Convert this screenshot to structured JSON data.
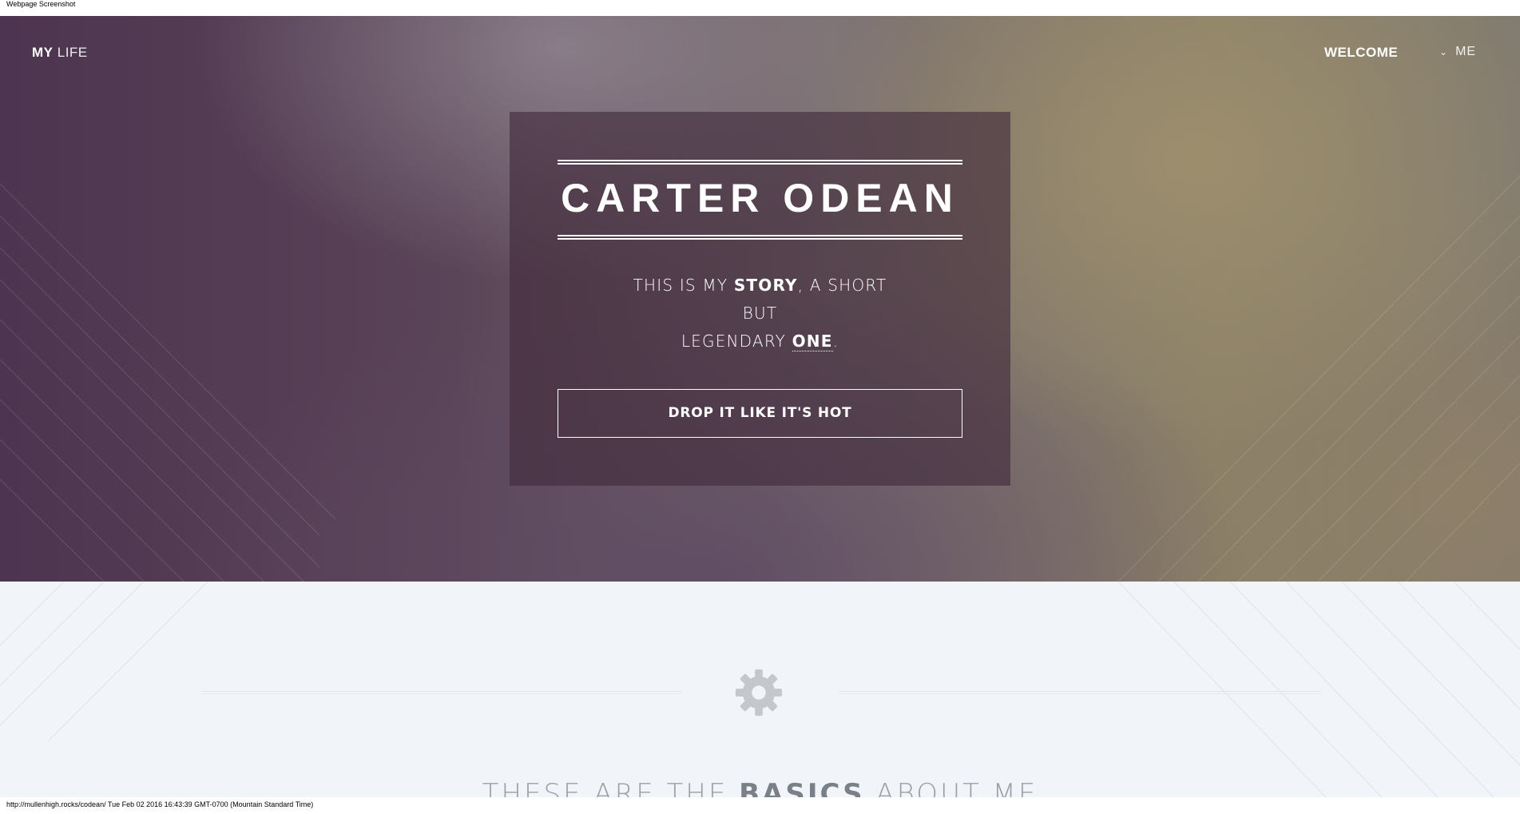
{
  "screenshot_caption": "Webpage Screenshot",
  "nav": {
    "logo_bold": "MY",
    "logo_light": "LIFE",
    "welcome_label": "WELCOME",
    "me_label": "ME",
    "me_icon": "chevron-down-icon"
  },
  "hero": {
    "title": "CARTER ODEAN",
    "tagline_part1": "THIS IS MY ",
    "tagline_story": "STORY",
    "tagline_part2": ", A SHORT",
    "tagline_line2": "BUT",
    "tagline_part3": "LEGENDARY ",
    "tagline_one": "ONE",
    "tagline_end": ".",
    "cta_label": "DROP IT LIKE IT'S HOT"
  },
  "basics": {
    "icon": "gear-icon",
    "heading_part1": "THESE ARE THE ",
    "heading_bold": "BASICS",
    "heading_part2": " ABOUT ME"
  },
  "status_bar": {
    "text": "http://mullenhigh.rocks/codean/ Tue Feb 02 2016 16:43:39 GMT-0700 (Mountain Standard Time)"
  },
  "colors": {
    "hero_card_bg": "#412a3c",
    "section_bg": "#f1f4f8",
    "gear": "#c4c7cb"
  }
}
